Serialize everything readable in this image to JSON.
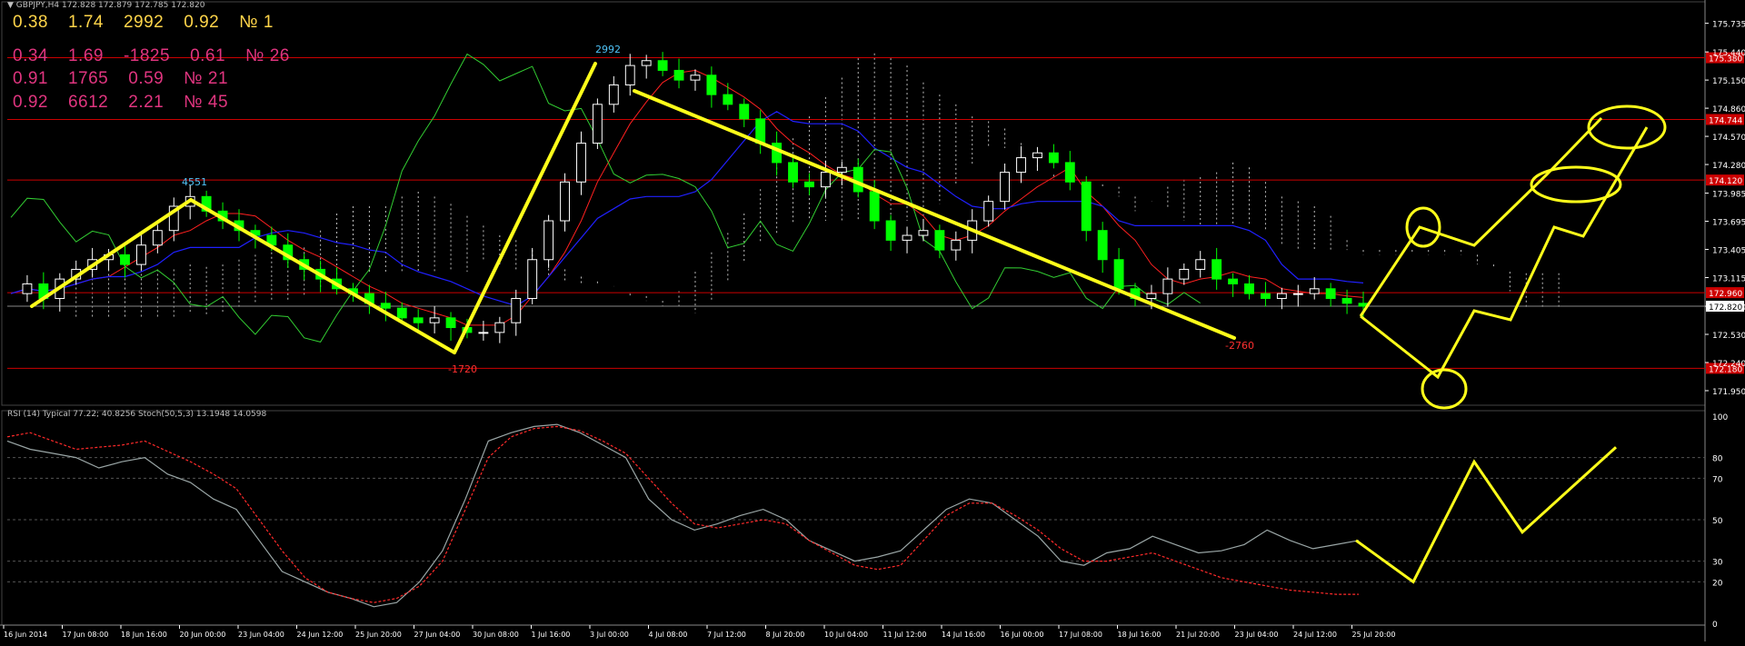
{
  "header": {
    "symbol_line": "GBPJPY,H4  172.828 172.879 172.785 172.820",
    "rsi_line": "RSI (14) Typical  77.22; 40.8256  Stoch(50,5,3) 13.1948 14.0598"
  },
  "info_lines": [
    {
      "values": [
        "0.38",
        "1.74",
        "2992",
        "0.92",
        "№ 1"
      ],
      "color": "#ffd54a"
    },
    {
      "values": [
        "0.34",
        "1.69",
        "-1825",
        "0.61",
        "№ 26"
      ],
      "color": "#e0357f"
    },
    {
      "values": [
        "0.91",
        "1765",
        "0.59",
        "№ 21"
      ],
      "color": "#e0357f"
    },
    {
      "values": [
        "0.92",
        "6612",
        "2.21",
        "№ 45"
      ],
      "color": "#e0357f"
    }
  ],
  "colors": {
    "background": "#000000",
    "bull_candle": "#ffffff",
    "bear_candle": "#00ff00",
    "hline": "#cc0000",
    "annotation": "#ffff1a",
    "tenkan": "#ff2020",
    "kijun": "#2020ff",
    "chikou": "#32cd32",
    "cloud": "#ffffff",
    "rsi": "#9aa6a6",
    "stoch_signal": "#ff2a2a",
    "grid": "#555555",
    "axis_text": "#ffffff"
  },
  "chart_data": [
    {
      "type": "candlestick",
      "title": "GBPJPY,H4",
      "ylim": [
        171.8,
        175.9
      ],
      "price_ticks": [
        "175.735",
        "175.440",
        "175.150",
        "174.860",
        "174.570",
        "174.280",
        "173.985",
        "173.695",
        "173.405",
        "173.115",
        "172.820",
        "172.530",
        "172.240",
        "171.950"
      ],
      "current_price": "172.820",
      "horizontal_levels": [
        {
          "label": "175.380",
          "value": 175.38
        },
        {
          "label": "174.744",
          "value": 174.744
        },
        {
          "label": "174.120",
          "value": 174.12
        },
        {
          "label": "172.960",
          "value": 172.96
        },
        {
          "label": "172.180",
          "value": 172.18
        }
      ],
      "x_ticks": [
        "16 Jun 2014",
        "17 Jun 08:00",
        "18 Jun 16:00",
        "20 Jun 00:00",
        "23 Jun 04:00",
        "24 Jun 12:00",
        "25 Jun 20:00",
        "27 Jun 04:00",
        "30 Jun 08:00",
        "1 Jul 16:00",
        "3 Jul 00:00",
        "4 Jul 08:00",
        "7 Jul 12:00",
        "8 Jul 20:00",
        "10 Jul 04:00",
        "11 Jul 12:00",
        "14 Jul 16:00",
        "16 Jul 00:00",
        "17 Jul 08:00",
        "18 Jul 16:00",
        "21 Jul 20:00",
        "23 Jul 04:00",
        "24 Jul 12:00",
        "25 Jul 20:00"
      ],
      "zigzag_labels": [
        {
          "text": "4551",
          "color": "#4fc3f7"
        },
        {
          "text": "2992",
          "color": "#4fc3f7"
        },
        {
          "text": "-1720",
          "color": "#ff3030"
        },
        {
          "text": "-2760",
          "color": "#ff3030"
        }
      ],
      "close_series": [
        172.95,
        173.05,
        172.9,
        173.1,
        173.2,
        173.3,
        173.35,
        173.25,
        173.45,
        173.6,
        173.85,
        173.95,
        173.8,
        173.7,
        173.6,
        173.55,
        173.45,
        173.3,
        173.2,
        173.1,
        173.0,
        172.95,
        172.85,
        172.8,
        172.7,
        172.65,
        172.7,
        172.6,
        172.55,
        172.55,
        172.65,
        172.9,
        173.3,
        173.7,
        174.1,
        174.5,
        174.9,
        175.1,
        175.3,
        175.35,
        175.25,
        175.15,
        175.2,
        175.0,
        174.9,
        174.75,
        174.5,
        174.3,
        174.1,
        174.05,
        174.2,
        174.25,
        174.0,
        173.7,
        173.5,
        173.55,
        173.6,
        173.4,
        173.5,
        173.7,
        173.9,
        174.2,
        174.35,
        174.4,
        174.3,
        174.1,
        173.6,
        173.3,
        173.0,
        172.9,
        172.95,
        173.1,
        173.2,
        173.3,
        173.1,
        173.05,
        172.95,
        172.9,
        172.95,
        172.95,
        173.0,
        172.9,
        172.85,
        172.82
      ]
    },
    {
      "type": "line",
      "title": "RSI (14) Typical",
      "ylim": [
        0,
        100
      ],
      "levels": [
        "100",
        "80",
        "70",
        "50",
        "30",
        "20",
        "0"
      ],
      "series": [
        {
          "name": "RSI (14) Typical",
          "values": [
            88,
            84,
            82,
            80,
            75,
            78,
            80,
            72,
            68,
            60,
            55,
            40,
            25,
            20,
            15,
            12,
            8,
            10,
            20,
            35,
            60,
            88,
            92,
            95,
            96,
            92,
            86,
            80,
            60,
            50,
            45,
            48,
            52,
            55,
            50,
            40,
            35,
            30,
            32,
            35,
            45,
            55,
            60,
            58,
            50,
            42,
            30,
            28,
            34,
            36,
            42,
            38,
            34,
            35,
            38,
            45,
            40,
            36,
            38,
            40
          ]
        },
        {
          "name": "Stoch(50,5,3)",
          "values": [
            90,
            92,
            88,
            84,
            85,
            86,
            88,
            83,
            78,
            72,
            65,
            50,
            35,
            22,
            15,
            12,
            10,
            12,
            18,
            30,
            55,
            80,
            90,
            94,
            95,
            93,
            88,
            82,
            70,
            58,
            48,
            46,
            48,
            50,
            48,
            40,
            34,
            28,
            26,
            28,
            40,
            52,
            58,
            58,
            52,
            45,
            36,
            30,
            30,
            32,
            34,
            30,
            26,
            22,
            20,
            18,
            16,
            15,
            14,
            14
          ]
        }
      ],
      "forecast_values": [
        40,
        20,
        78,
        44,
        85
      ]
    }
  ]
}
